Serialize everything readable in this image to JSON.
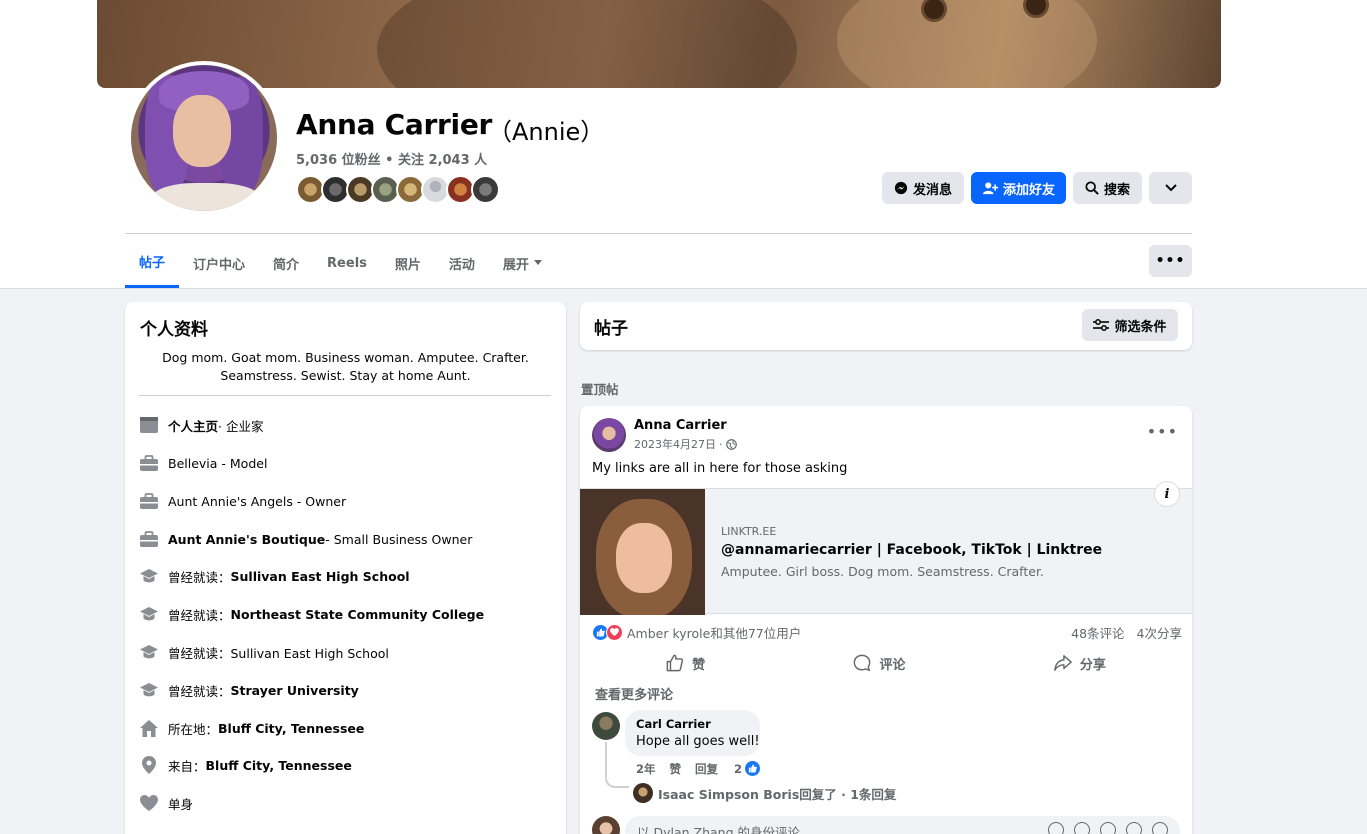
{
  "profile": {
    "name": "Anna Carrier",
    "alt_name": "（Annie）",
    "stats": "5,036 位粉丝 • 关注 2,043 人"
  },
  "header_buttons": {
    "message": "发消息",
    "add_friend": "添加好友",
    "search": "搜索"
  },
  "tabs": [
    {
      "label": "帖子",
      "active": true
    },
    {
      "label": "订户中心"
    },
    {
      "label": "简介"
    },
    {
      "label": "Reels"
    },
    {
      "label": "照片"
    },
    {
      "label": "活动"
    },
    {
      "label": "展开"
    }
  ],
  "intro": {
    "title": "个人资料",
    "bio": "Dog mom. Goat mom. Business woman. Amputee. Crafter. Seamstress. Sewist. Stay at home Aunt.",
    "items": [
      {
        "icon": "page-icon",
        "bold": "个人主页",
        "text": " · 企业家"
      },
      {
        "icon": "briefcase-icon",
        "bold": "",
        "text": "Bellevia - Model"
      },
      {
        "icon": "briefcase-icon",
        "bold": "",
        "text": "Aunt Annie's Angels - Owner"
      },
      {
        "icon": "briefcase-icon",
        "bold": "Aunt Annie's Boutique",
        "text": " - Small Business Owner"
      },
      {
        "icon": "graduation-cap-icon",
        "text": "曾经就读：",
        "bold": "Sullivan East High School"
      },
      {
        "icon": "graduation-cap-icon",
        "text": "曾经就读：",
        "bold": "Northeast State Community College"
      },
      {
        "icon": "graduation-cap-icon",
        "text": "曾经就读：Sullivan East High School",
        "bold": ""
      },
      {
        "icon": "graduation-cap-icon",
        "text": "曾经就读：",
        "bold": "Strayer University"
      },
      {
        "icon": "home-icon",
        "text": "所在地：",
        "bold": "Bluff City, Tennessee"
      },
      {
        "icon": "location-pin-icon",
        "text": "来自：",
        "bold": "Bluff City, Tennessee"
      },
      {
        "icon": "heart-icon",
        "text": "单身",
        "bold": ""
      }
    ]
  },
  "posts_header": {
    "title": "帖子",
    "filter": "筛选条件"
  },
  "pinned_label": "置顶帖",
  "post": {
    "author": "Anna Carrier",
    "date": "2023年4月27日",
    "text": "My links are all in here for those asking",
    "link": {
      "domain": "LINKTR.EE",
      "title": "@annamariecarrier | Facebook, TikTok | Linktree",
      "description": "Amputee. Girl boss. Dog mom. Seamstress. Crafter."
    },
    "reactions_text": "Amber kyrole和其他77位用户",
    "comments_count": "48条评论",
    "shares_count": "4次分享",
    "actions": {
      "like": "赞",
      "comment": "评论",
      "share": "分享"
    },
    "more_comments": "查看更多评论",
    "comment": {
      "author": "Carl Carrier",
      "text": "Hope all goes well!",
      "age": "2年",
      "like": "赞",
      "reply": "回复",
      "likes": "2"
    },
    "reply_summary": "Isaac Simpson Boris回复了 · 1条回复",
    "composer_placeholder": "以 Dylan Zhang 的身份评论"
  },
  "colors": {
    "accent": "#0866ff",
    "background": "#f0f2f5",
    "secondary_text": "#65676b"
  }
}
